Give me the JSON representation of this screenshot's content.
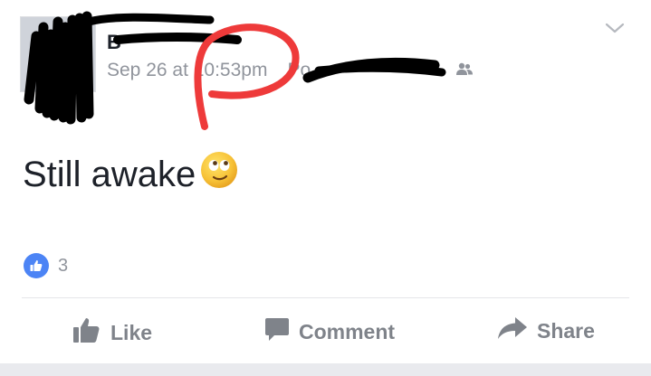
{
  "post": {
    "author": "B",
    "timestamp": "Sep 26 at 10:53pm",
    "meta_suffix": "Po",
    "privacy_icon": "friends-icon",
    "status_text": "Still awake",
    "emoji": "slightly-smiling-face-emoji",
    "like_count": "3"
  },
  "actions": {
    "like_label": "Like",
    "comment_label": "Comment",
    "share_label": "Share"
  },
  "colors": {
    "text": "#1d2129",
    "meta": "#90949c",
    "action": "#7f838a",
    "like_blue": "#4c84f5",
    "annotation_red": "#ee3a3a",
    "redaction_black": "#000000"
  }
}
